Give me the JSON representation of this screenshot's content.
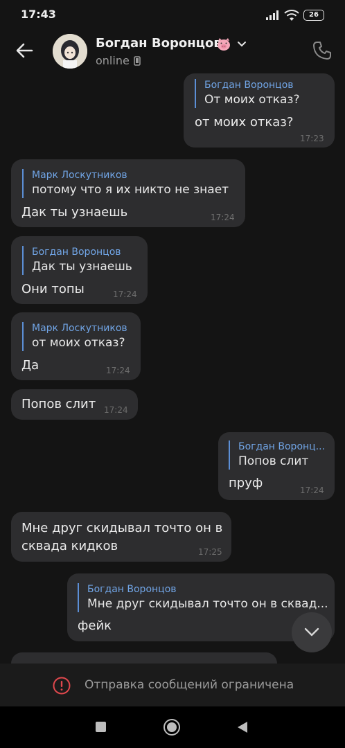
{
  "status_bar": {
    "time": "17:43",
    "battery": "26"
  },
  "header": {
    "contact_name": "Богдан Воронцов",
    "name_emoji": "🐷",
    "presence": "online"
  },
  "messages": [
    {
      "reply_name": "Богдан Воронцов",
      "reply_text": "От моих отказ?",
      "text": "от моих отказ?",
      "time": "17:23"
    },
    {
      "reply_name": "Марк Лоскутников",
      "reply_text": "потому что я их никто не знает",
      "text": "Дак ты узнаешь",
      "time": "17:24"
    },
    {
      "reply_name": "Богдан Воронцов",
      "reply_text": "Дак ты узнаешь",
      "text": "Они топы",
      "time": "17:24"
    },
    {
      "reply_name": "Марк Лоскутников",
      "reply_text": "от моих отказ?",
      "text": "Да",
      "time": "17:24"
    },
    {
      "text": "Попов слит",
      "time": "17:24"
    },
    {
      "reply_name": "Богдан Воронц...",
      "reply_text": "Попов слит",
      "text": "пруф",
      "time": "17:24"
    },
    {
      "text_line1": "Мне друг скидывал точто он в",
      "text_line2": "сквада кидков",
      "time": "17:25"
    },
    {
      "reply_name": "Богдан Воронцов",
      "reply_text": "Мне друг скидывал точто он в сквад...",
      "text": "фейк"
    }
  ],
  "restriction": {
    "text": "Отправка сообщений ограничена"
  },
  "colors": {
    "background": "#141414",
    "bubble": "#2d2d2f",
    "reply_accent": "#5c8fd6",
    "reply_name": "#71a5e6",
    "warning": "#e0484d"
  }
}
